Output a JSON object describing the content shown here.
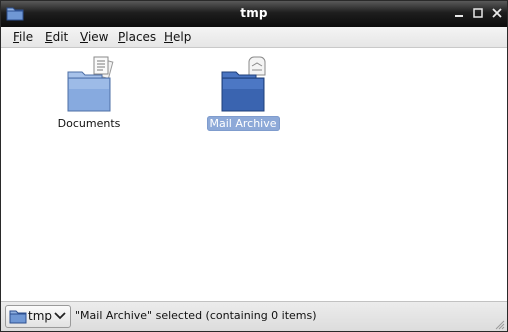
{
  "window": {
    "title": "tmp",
    "icon": "folder-icon",
    "controls": [
      "minimize-icon",
      "maximize-icon",
      "close-icon"
    ]
  },
  "menubar": {
    "items": [
      {
        "label": "File",
        "mnemonic": "F",
        "rest": "ile"
      },
      {
        "label": "Edit",
        "mnemonic": "E",
        "rest": "dit"
      },
      {
        "label": "View",
        "mnemonic": "V",
        "rest": "iew"
      },
      {
        "label": "Places",
        "mnemonic": "P",
        "rest": "laces"
      },
      {
        "label": "Help",
        "mnemonic": "H",
        "rest": "elp"
      }
    ]
  },
  "files": [
    {
      "name": "Documents",
      "icon": "documents-folder-icon",
      "selected": false
    },
    {
      "name": "Mail Archive",
      "icon": "mail-folder-icon",
      "selected": true
    }
  ],
  "statusbar": {
    "location_label": "tmp",
    "location_icon": "folder-icon",
    "status_text": "\"Mail Archive\" selected (containing 0 items)"
  },
  "colors": {
    "titlebar": "#1e1e1e",
    "folder_light": "#7ea2d8",
    "folder_dark": "#3a64b0",
    "selection": "#8da9d8"
  }
}
